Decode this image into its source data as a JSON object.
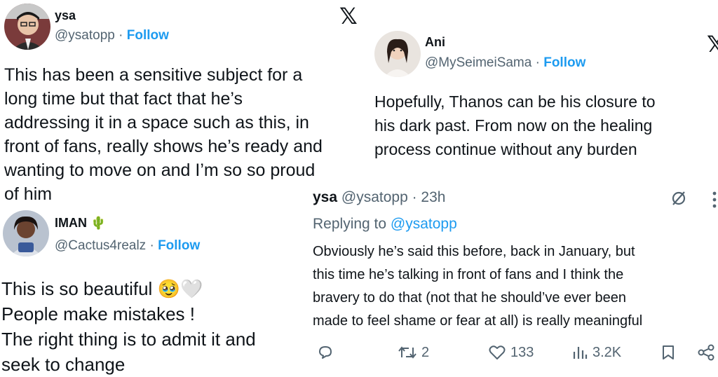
{
  "tweet1": {
    "name": "ysa",
    "handle": "@ysatopp",
    "separator": "·",
    "follow": "Follow",
    "x_logo": "𝕏",
    "lines": [
      "This has been a sensitive subject for a",
      "long time but that fact that he’s",
      "addressing it in a space such as this, in",
      "front of fans, really shows he’s ready and",
      "wanting to move on and I’m so so proud",
      "of him"
    ]
  },
  "tweet2": {
    "name": "Ani",
    "handle": "@MySeimeiSama",
    "separator": "·",
    "follow": "Follow",
    "x_logo": "𝕏",
    "lines": [
      "Hopefully, Thanos can be his closure to",
      "his dark past. From now on the healing",
      "process continue without any burden"
    ]
  },
  "tweet3": {
    "name": "IMAN",
    "name_emoji": "🌵",
    "handle": "@Cactus4realz",
    "separator": "·",
    "follow": "Follow",
    "lines": [
      "This is so beautiful",
      "People make mistakes !",
      "The right thing is to admit it and",
      "seek to change"
    ],
    "emoji": "🥹",
    "heart_emoji": "🤍"
  },
  "tweet4": {
    "name": "ysa",
    "handle": "@ysatopp",
    "time": "· 23h",
    "replying_prefix": "Replying to",
    "replying_handle": "@ysatopp",
    "lines": [
      "Obviously he’s said this before, back in January, but",
      "this time he’s talking in front of fans and I think the",
      "bravery to do that (not that he should’ve ever been",
      "made to feel shame or fear at all) is really meaningful"
    ],
    "actions": {
      "reply_icon": "reply-icon",
      "retweet_count": "2",
      "like_count": "133",
      "views_count": "3.2K",
      "bookmark_icon": "bookmark-icon",
      "share_icon": "share-icon"
    }
  },
  "colors": {
    "text": "#0f1419",
    "secondary": "#536471",
    "accent": "#1d9bf0"
  }
}
